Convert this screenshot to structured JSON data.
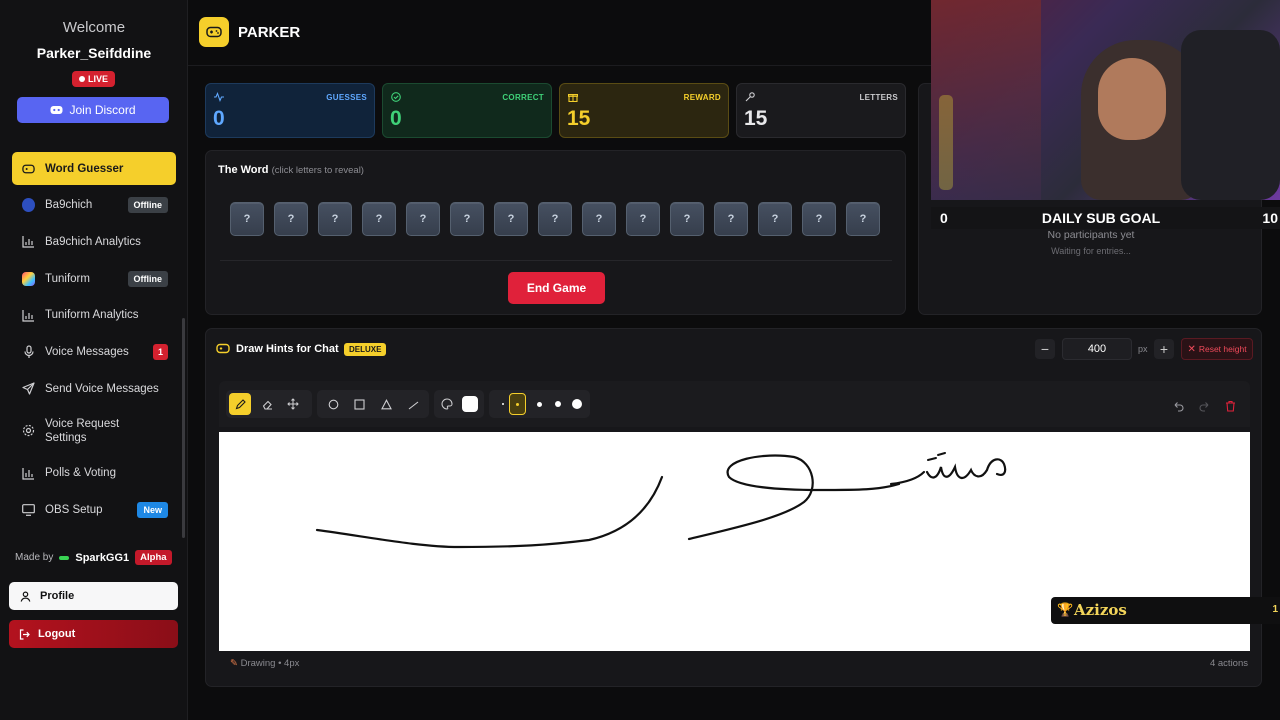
{
  "sidebar": {
    "welcome": "Welcome",
    "username": "Parker_Seifddine",
    "live": "LIVE",
    "discord_label": "Join Discord",
    "items": [
      {
        "label": "Word Guesser"
      },
      {
        "label": "Ba9chich",
        "badge": "Offline"
      },
      {
        "label": "Ba9chich Analytics"
      },
      {
        "label": "Tuniform",
        "badge": "Offline"
      },
      {
        "label": "Tuniform Analytics"
      },
      {
        "label": "Voice Messages",
        "badge": "1"
      },
      {
        "label": "Send Voice Messages"
      },
      {
        "label": "Voice Request Settings"
      },
      {
        "label": "Polls & Voting"
      },
      {
        "label": "OBS Setup",
        "badge": "New"
      }
    ],
    "made_by": "Made by",
    "author": "SparkGG1",
    "alpha": "Alpha",
    "profile": "Profile",
    "logout": "Logout"
  },
  "header": {
    "title": "PARKER"
  },
  "stats": [
    {
      "label": "GUESSES",
      "value": "0",
      "color": "#5fa8ff"
    },
    {
      "label": "CORRECT",
      "value": "0",
      "color": "#3fd178"
    },
    {
      "label": "REWARD",
      "value": "15",
      "color": "#f5cf2b"
    },
    {
      "label": "LETTERS",
      "value": "15",
      "color": "#c9c9cc"
    }
  ],
  "word": {
    "title": "The Word",
    "hint": "(click letters to reveal)",
    "tiles": [
      "?",
      "?",
      "?",
      "?",
      "?",
      "?",
      "?",
      "?",
      "?",
      "?",
      "?",
      "?",
      "?",
      "?",
      "?"
    ],
    "end_button": "End Game"
  },
  "goal": {
    "start": "0",
    "title": "DAILY SUB GOAL",
    "target": "10",
    "no_participants": "No participants yet",
    "waiting": "Waiting for entries..."
  },
  "draw": {
    "title": "Draw Hints for Chat",
    "deluxe": "DELUXE",
    "height_value": "400",
    "px": "px",
    "minus": "−",
    "plus": "+",
    "reset": "Reset height",
    "status": "Drawing • 4px",
    "actions": "4 actions"
  },
  "overlay": {
    "name": "Azizos",
    "count": "1"
  },
  "colors": {
    "accent": "#f5cf2b",
    "danger": "#e0213a",
    "discord": "#5865f2"
  }
}
